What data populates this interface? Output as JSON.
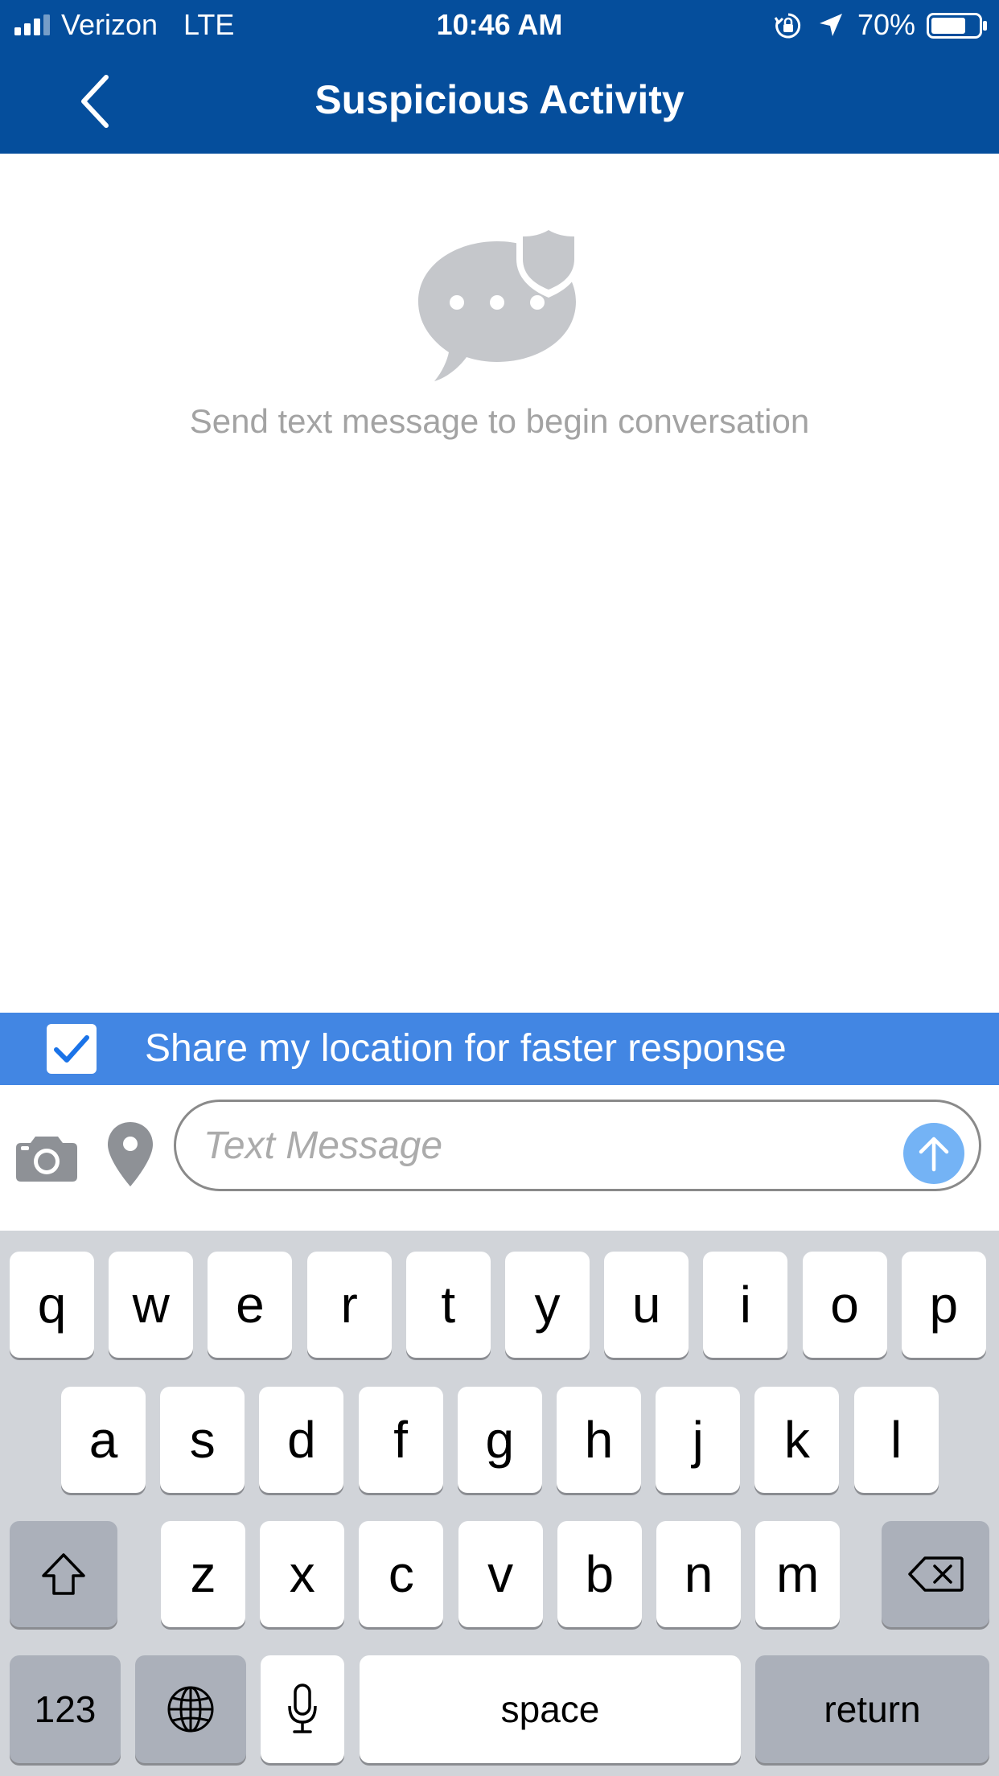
{
  "status_bar": {
    "carrier": "Verizon",
    "network": "LTE",
    "time": "10:46 AM",
    "battery_percent": "70%",
    "battery_level": 0.7,
    "icons": [
      "signal-icon",
      "orientation-lock-icon",
      "location-arrow-icon",
      "battery-icon"
    ]
  },
  "nav": {
    "title": "Suspicious Activity",
    "back_icon": "chevron-left-icon"
  },
  "empty_state": {
    "icon": "chat-bubble-shield-icon",
    "message": "Send text message to begin conversation"
  },
  "share_location": {
    "label": "Share my location for faster response",
    "checked": true
  },
  "composer": {
    "placeholder": "Text Message",
    "value": "",
    "icons": [
      "camera-icon",
      "location-pin-icon",
      "send-arrow-icon"
    ]
  },
  "keyboard": {
    "row1": [
      "q",
      "w",
      "e",
      "r",
      "t",
      "y",
      "u",
      "i",
      "o",
      "p"
    ],
    "row2": [
      "a",
      "s",
      "d",
      "f",
      "g",
      "h",
      "j",
      "k",
      "l"
    ],
    "row3": [
      "z",
      "x",
      "c",
      "v",
      "b",
      "n",
      "m"
    ],
    "numbers_label": "123",
    "space_label": "space",
    "return_label": "return"
  },
  "colors": {
    "header": "#054e9c",
    "share_bar": "#4286e3",
    "send_button": "#74b3f5",
    "keyboard_bg": "#d1d4d9",
    "empty_text": "#a3a3a3"
  }
}
